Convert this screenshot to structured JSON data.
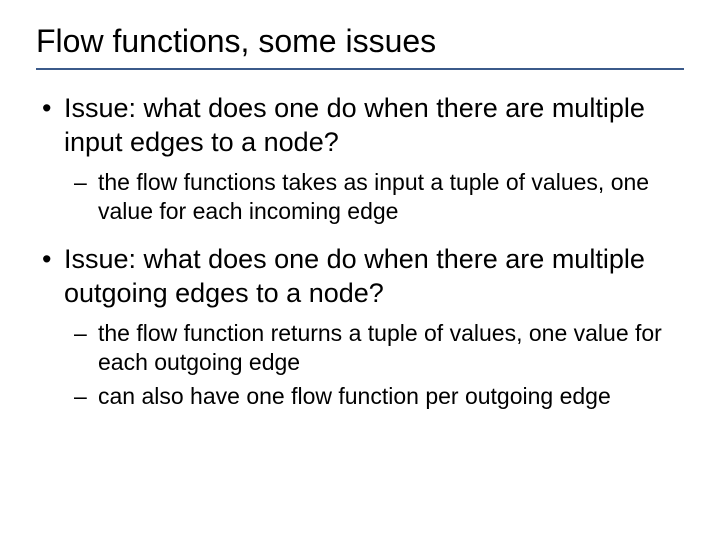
{
  "title": "Flow functions, some issues",
  "bullets": [
    {
      "text": "Issue: what does one do when there are multiple input edges to a node?",
      "sub": [
        "the flow functions takes as input a tuple of values, one value for each incoming edge"
      ]
    },
    {
      "text": "Issue: what does one do when there are multiple outgoing edges to a node?",
      "sub": [
        "the flow function returns a tuple of values, one value for each outgoing edge",
        "can also have one flow function per outgoing edge"
      ]
    }
  ]
}
